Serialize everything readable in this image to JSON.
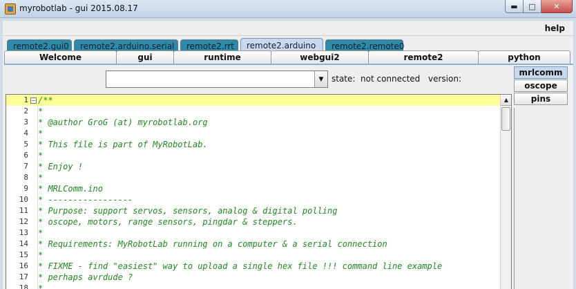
{
  "window": {
    "title": "myrobotlab - gui 2015.08.17"
  },
  "menu": {
    "help_label": "help"
  },
  "service_tabs": [
    {
      "label": "remote2.gui0",
      "active": false
    },
    {
      "label": "remote2.arduino.serial",
      "active": false
    },
    {
      "label": "remote2.rrt",
      "active": false
    },
    {
      "label": "remote2.arduino",
      "active": true
    },
    {
      "label": "remote2.remote0",
      "active": false
    }
  ],
  "sub_tabs": [
    {
      "label": "Welcome"
    },
    {
      "label": "gui"
    },
    {
      "label": "runtime"
    },
    {
      "label": "webgui2"
    },
    {
      "label": "remote2"
    },
    {
      "label": "python"
    }
  ],
  "port_select": {
    "value": ""
  },
  "status": {
    "state_label": "state:",
    "state_value": "not connected",
    "version_label": "version:"
  },
  "side_tabs": [
    {
      "label": "mrlcomm",
      "active": true
    },
    {
      "label": "oscope",
      "active": false
    },
    {
      "label": "pins",
      "active": false
    }
  ],
  "editor": {
    "current_line": 1,
    "lines": [
      {
        "num": "1",
        "text": "/**"
      },
      {
        "num": "2",
        "text": "*"
      },
      {
        "num": "3",
        "text": "* @author GroG (at) myrobotlab.org"
      },
      {
        "num": "4",
        "text": "*"
      },
      {
        "num": "5",
        "text": "* This file is part of MyRobotLab."
      },
      {
        "num": "6",
        "text": "*"
      },
      {
        "num": "7",
        "text": "* Enjoy !"
      },
      {
        "num": "8",
        "text": "*"
      },
      {
        "num": "9",
        "text": "* MRLComm.ino"
      },
      {
        "num": "10",
        "text": "* -----------------"
      },
      {
        "num": "11",
        "text": "* Purpose: support servos, sensors, analog & digital polling"
      },
      {
        "num": "12",
        "text": "* oscope, motors, range sensors, pingdar & steppers."
      },
      {
        "num": "13",
        "text": "*"
      },
      {
        "num": "14",
        "text": "* Requirements: MyRobotLab running on a computer & a serial connection"
      },
      {
        "num": "15",
        "text": "*"
      },
      {
        "num": "16",
        "text": "* FIXME - find \"easiest\" way to upload a single hex file !!! command line example"
      },
      {
        "num": "17",
        "text": "* perhaps avrdude ?"
      },
      {
        "num": "18",
        "text": "*"
      }
    ]
  }
}
